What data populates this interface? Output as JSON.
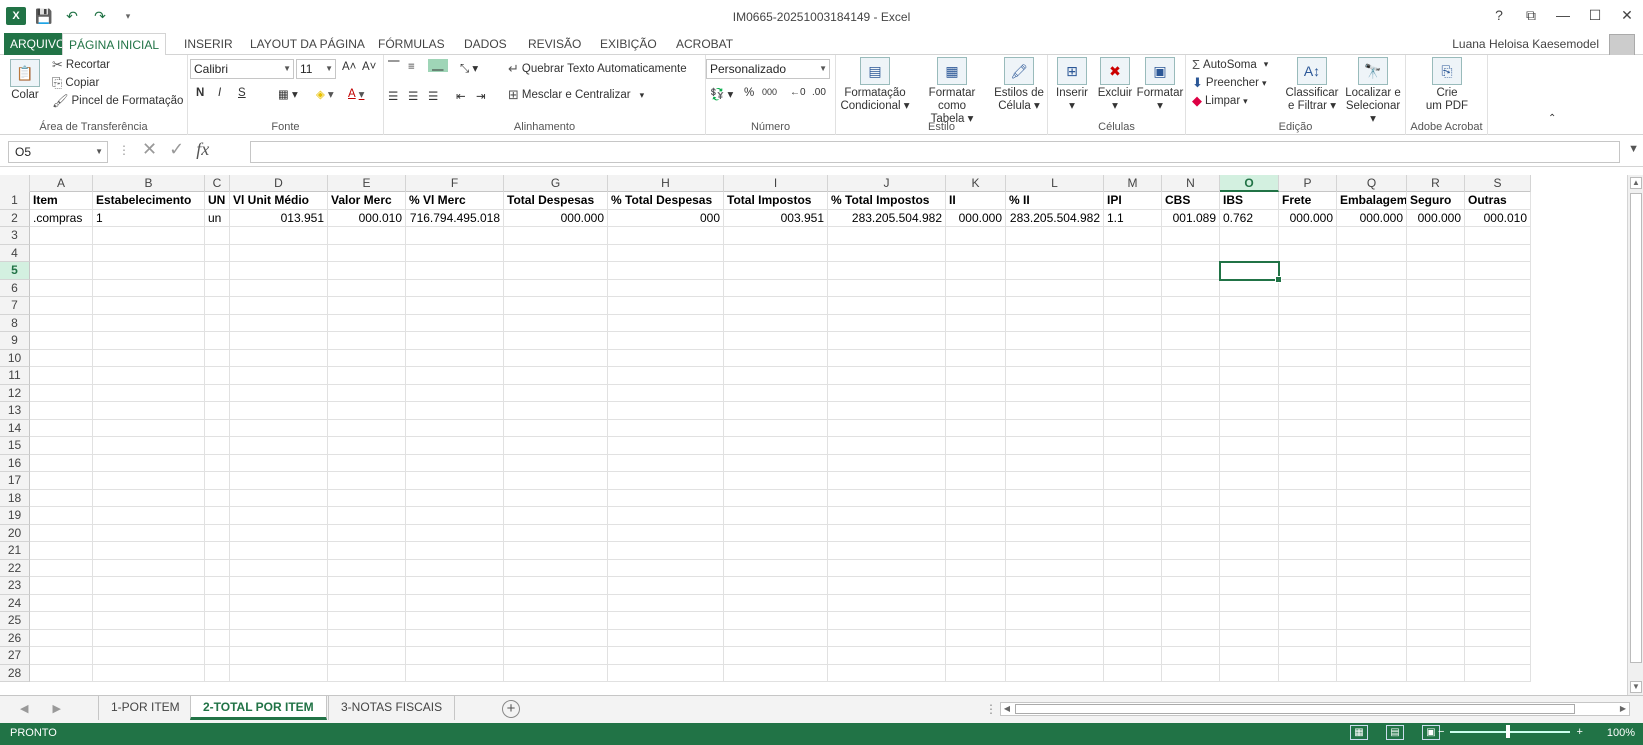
{
  "titlebar": {
    "title": "IM0665-20251003184149 - Excel",
    "help": "?",
    "restore_ribbon": "⧉",
    "minimize": "—",
    "maximize": "☐",
    "close": "✕"
  },
  "tabs": {
    "file": "ARQUIVO",
    "home": "PÁGINA INICIAL",
    "insert": "INSERIR",
    "layout": "LAYOUT DA PÁGINA",
    "formulas": "FÓRMULAS",
    "data": "DADOS",
    "review": "REVISÃO",
    "view": "EXIBIÇÃO",
    "acrobat": "ACROBAT",
    "user": "Luana Heloisa Kaesemodel"
  },
  "ribbon": {
    "clipboard": {
      "label": "Área de Transferência",
      "paste": "Colar",
      "cut": "Recortar",
      "copy": "Copiar",
      "format_painter": "Pincel de Formatação"
    },
    "font": {
      "label": "Fonte",
      "name": "Calibri",
      "size": "11",
      "bold": "N",
      "italic": "I",
      "underline": "S"
    },
    "alignment": {
      "label": "Alinhamento",
      "wrap": "Quebrar Texto Automaticamente",
      "merge": "Mesclar e Centralizar"
    },
    "number": {
      "label": "Número",
      "format": "Personalizado",
      "percent": "%",
      "thousands": "000"
    },
    "styles": {
      "label": "Estilo",
      "cond_format_1": "Formatação",
      "cond_format_2": "Condicional",
      "table_1": "Formatar como",
      "table_2": "Tabela",
      "cell_styles_1": "Estilos de",
      "cell_styles_2": "Célula"
    },
    "cells": {
      "label": "Células",
      "insert": "Inserir",
      "delete": "Excluir",
      "format": "Formatar"
    },
    "editing": {
      "label": "Edição",
      "autosum": "AutoSoma",
      "fill": "Preencher",
      "clear": "Limpar",
      "sort_1": "Classificar",
      "sort_2": "e Filtrar",
      "find_1": "Localizar e",
      "find_2": "Selecionar"
    },
    "acrobat": {
      "label": "Adobe Acrobat",
      "create_1": "Crie",
      "create_2": "um PDF"
    }
  },
  "formula_bar": {
    "name_box": "O5",
    "fx": "fx",
    "formula": ""
  },
  "grid": {
    "columns": [
      "A",
      "B",
      "C",
      "D",
      "E",
      "F",
      "G",
      "H",
      "I",
      "J",
      "K",
      "L",
      "M",
      "N",
      "O",
      "P",
      "Q",
      "R",
      "S"
    ],
    "rows": [
      "1",
      "2",
      "3",
      "4",
      "5",
      "6",
      "7",
      "8",
      "9",
      "10",
      "11",
      "12",
      "13",
      "14",
      "15",
      "16",
      "17",
      "18",
      "19",
      "20",
      "21",
      "22",
      "23",
      "24",
      "25",
      "26",
      "27",
      "28"
    ],
    "header_row": [
      "Item",
      "Estabelecimento",
      "UN",
      "Vl Unit Médio",
      "Valor Merc",
      "% Vl Merc",
      "Total Despesas",
      "% Total Despesas",
      "Total Impostos",
      "% Total Impostos",
      "II",
      "% II",
      "IPI",
      "CBS",
      "IBS",
      "Frete",
      "Embalagem",
      "Seguro",
      "Outras"
    ],
    "data_row": [
      ".compras",
      "1",
      "un",
      "013.951",
      "000.010",
      "716.794.495.018",
      "000.000",
      "000",
      "003.951",
      "283.205.504.982",
      "000.000",
      "283.205.504.982",
      "1.1",
      "001.089",
      "0.762",
      "000.000",
      "000.000",
      "000.000",
      "000.010"
    ]
  },
  "sheets": {
    "tab1": "1-POR ITEM",
    "tab2": "2-TOTAL POR ITEM",
    "tab3": "3-NOTAS FISCAIS",
    "add": "+"
  },
  "status": {
    "mode": "PRONTO",
    "zoom": "100%",
    "zoom_minus": "−",
    "zoom_plus": "+"
  }
}
